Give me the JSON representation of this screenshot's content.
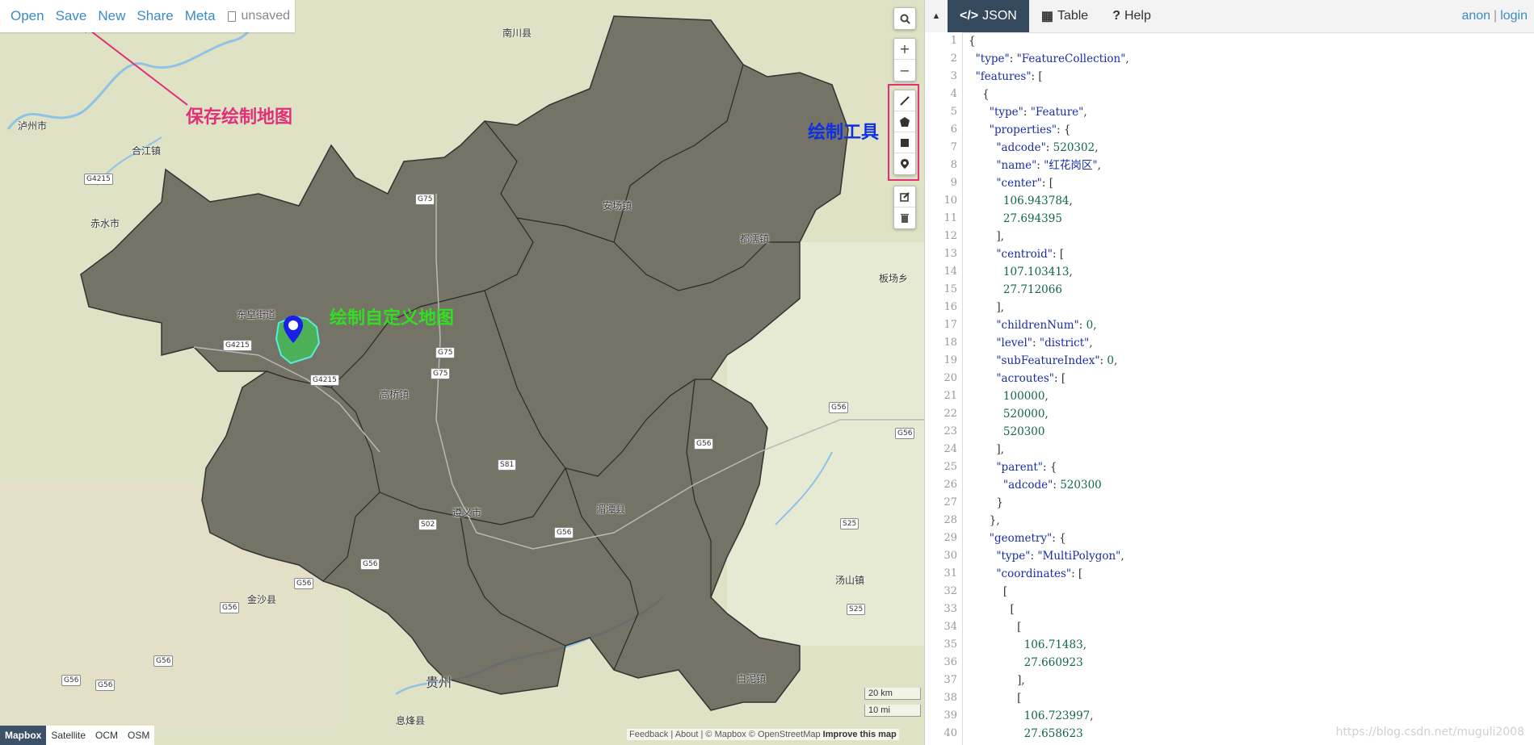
{
  "toolbar": {
    "open": "Open",
    "save": "Save",
    "new": "New",
    "share": "Share",
    "meta": "Meta",
    "status": "unsaved"
  },
  "annotations": {
    "save_note": "保存绘制地图",
    "tools_note": "绘制工具",
    "draw_note": "绘制自定义地图"
  },
  "map_labels": {
    "nanchuan": "南川县",
    "luzhou": "泸州市",
    "hejiang": "合江镇",
    "chishui": "赤水市",
    "donghuang": "东皇街道",
    "anchang": "安场镇",
    "duzhuang": "都濡镇",
    "banchang": "板场乡",
    "gaoqiao": "高桥镇",
    "zunyi": "遵义市",
    "meitan": "湄潭县",
    "jinsha": "金沙县",
    "tangshan": "汤山镇",
    "guizhou": "贵州",
    "baini": "白泥镇",
    "xifeng": "息烽县"
  },
  "road_labels": [
    "G4215",
    "G75",
    "G4215",
    "G75",
    "G75",
    "G4215",
    "S81",
    "S02",
    "G56",
    "G56",
    "G56",
    "G56",
    "G56",
    "G56",
    "S25",
    "S25",
    "G56",
    "G56",
    "G56",
    "G56"
  ],
  "map_controls": {
    "search_icon": "search-icon",
    "zoom_in": "+",
    "zoom_out": "−"
  },
  "layers": [
    "Mapbox",
    "Satellite",
    "OCM",
    "OSM"
  ],
  "scale": {
    "km": "20 km",
    "mi": "10 mi"
  },
  "attribution": {
    "feedback": "Feedback",
    "about": "About",
    "mapbox": "© Mapbox",
    "osm": "© OpenStreetMap",
    "improve": "Improve this map"
  },
  "panel": {
    "tabs": [
      {
        "icon": "</>",
        "label": "JSON"
      },
      {
        "icon": "▦",
        "label": "Table"
      },
      {
        "icon": "?",
        "label": "Help"
      }
    ],
    "user": {
      "anon": "anon",
      "sep": "|",
      "login": "login"
    }
  },
  "code_lines": [
    "{",
    "  \"type\": \"FeatureCollection\",",
    "  \"features\": [",
    "    {",
    "      \"type\": \"Feature\",",
    "      \"properties\": {",
    "        \"adcode\": 520302,",
    "        \"name\": \"红花岗区\",",
    "        \"center\": [",
    "          106.943784,",
    "          27.694395",
    "        ],",
    "        \"centroid\": [",
    "          107.103413,",
    "          27.712066",
    "        ],",
    "        \"childrenNum\": 0,",
    "        \"level\": \"district\",",
    "        \"subFeatureIndex\": 0,",
    "        \"acroutes\": [",
    "          100000,",
    "          520000,",
    "          520300",
    "        ],",
    "        \"parent\": {",
    "          \"adcode\": 520300",
    "        }",
    "      },",
    "      \"geometry\": {",
    "        \"type\": \"MultiPolygon\",",
    "        \"coordinates\": [",
    "          [",
    "            [",
    "              [",
    "                106.71483,",
    "                27.660923",
    "              ],",
    "              [",
    "                106.723997,",
    "                27.658623"
  ],
  "watermark": "https://blog.csdn.net/muguli2008",
  "colors": {
    "link": "#3c8ac4",
    "annot_pink": "#e0307a",
    "annot_blue": "#1030e0",
    "annot_green": "#33dd22",
    "region_fill": "#5d5a50",
    "drawn_fill": "#44bb55"
  }
}
